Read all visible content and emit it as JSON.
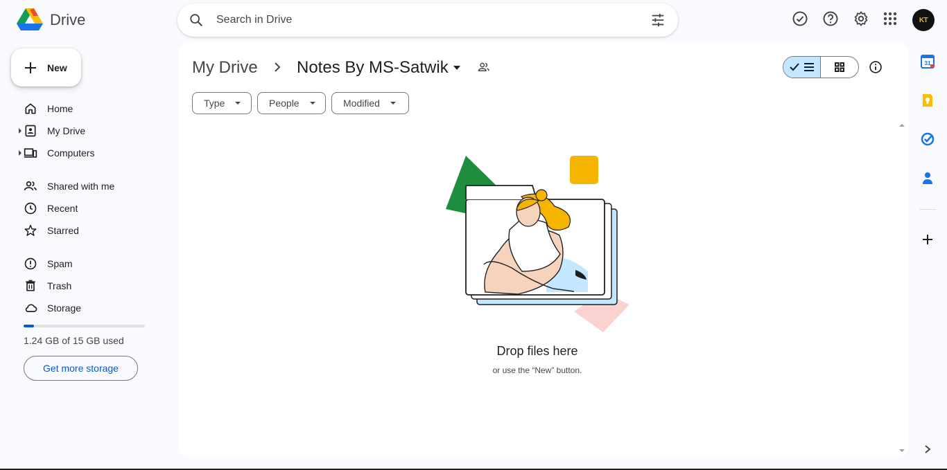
{
  "app": {
    "name": "Drive"
  },
  "search": {
    "placeholder": "Search in Drive",
    "value": ""
  },
  "header_icons": [
    "offline-ready-icon",
    "help-icon",
    "settings-icon",
    "apps-grid-icon"
  ],
  "account": {
    "initials": "KT"
  },
  "sidebar": {
    "new_label": "New",
    "items": [
      {
        "label": "Home",
        "icon": "home-icon"
      },
      {
        "label": "My Drive",
        "icon": "my-drive-icon",
        "expandable": true
      },
      {
        "label": "Computers",
        "icon": "computers-icon",
        "expandable": true
      },
      {
        "label": "Shared with me",
        "icon": "shared-icon"
      },
      {
        "label": "Recent",
        "icon": "clock-icon"
      },
      {
        "label": "Starred",
        "icon": "star-icon"
      },
      {
        "label": "Spam",
        "icon": "spam-icon"
      },
      {
        "label": "Trash",
        "icon": "trash-icon"
      },
      {
        "label": "Storage",
        "icon": "cloud-icon"
      }
    ],
    "storage": {
      "used_fraction": 0.083,
      "text": "1.24 GB of 15 GB used",
      "button": "Get more storage"
    }
  },
  "breadcrumb": {
    "root": "My Drive",
    "current": "Notes By MS-Satwik"
  },
  "filters": [
    "Type",
    "People",
    "Modified"
  ],
  "view": {
    "active": "list"
  },
  "empty_state": {
    "title": "Drop files here",
    "subtitle": "or use the “New” button."
  },
  "colors": {
    "accent": "#0b57d0",
    "toggle_active": "#c2e7ff",
    "background": "#f8fafd"
  },
  "right_rail": [
    "calendar-icon",
    "keep-icon",
    "tasks-icon",
    "contacts-icon",
    "add-icon"
  ]
}
